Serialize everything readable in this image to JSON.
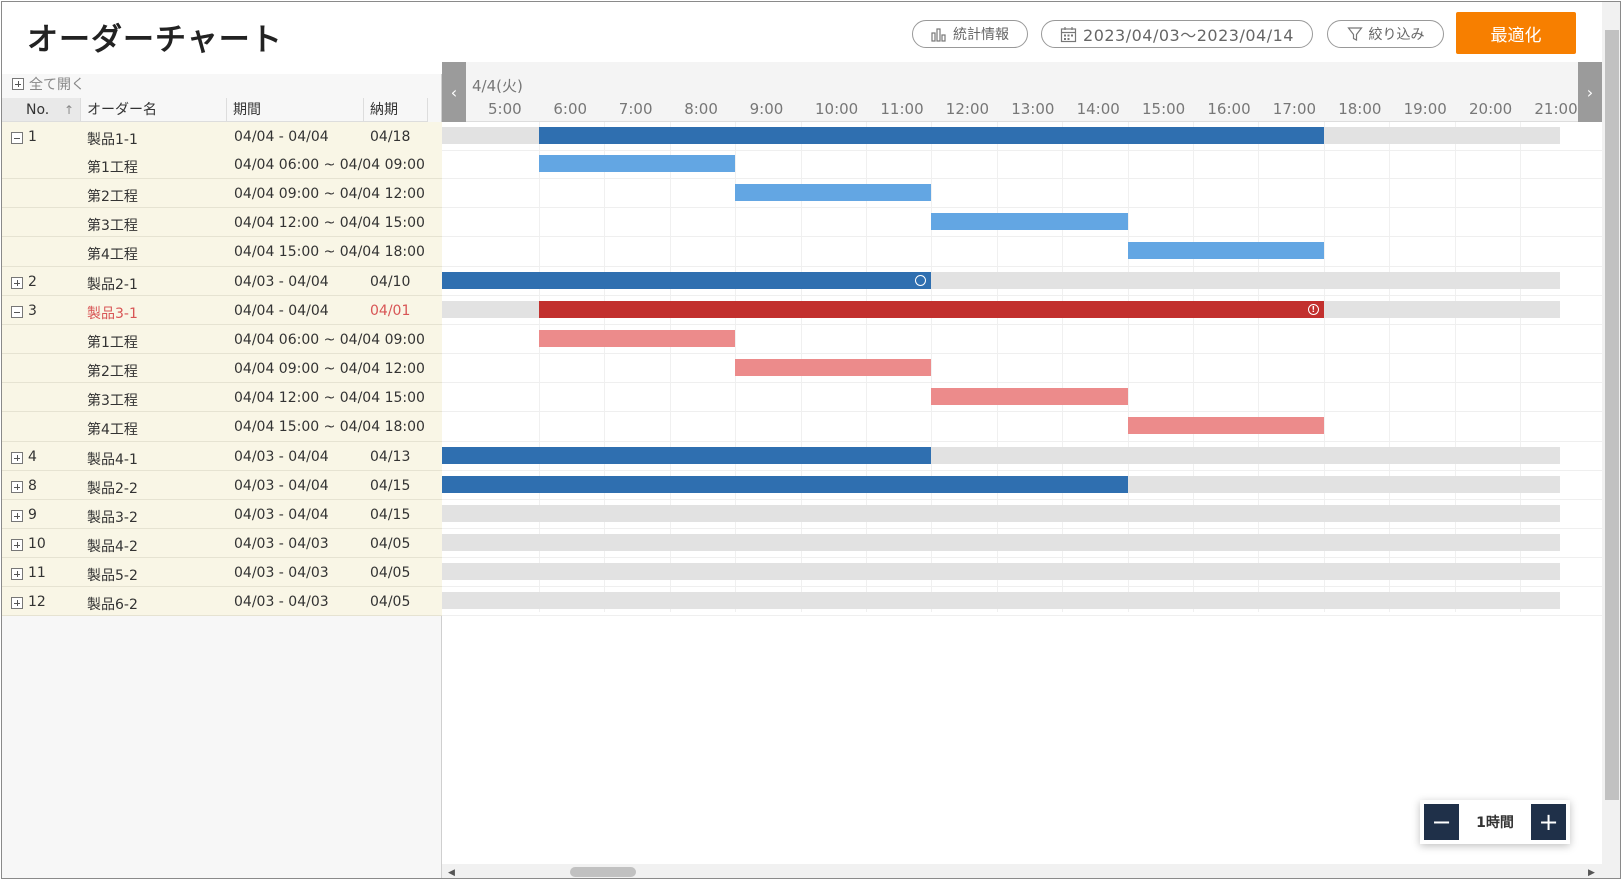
{
  "header": {
    "title": "オーダーチャート",
    "stats_label": "統計情報",
    "date_range": "2023/04/03〜2023/04/14",
    "filter_label": "絞り込み",
    "optimize_label": "最適化",
    "accent_color": "#f77f00"
  },
  "left": {
    "expand_all": "全て開く",
    "columns": {
      "no": "No.",
      "sort_icon": "↑",
      "name": "オーダー名",
      "period": "期間",
      "due": "納期"
    },
    "rows": [
      {
        "toggle": "minus",
        "no": "1",
        "name": "製品1-1",
        "period": "04/04 - 04/04",
        "due": "04/18",
        "kind": "order"
      },
      {
        "toggle": "",
        "no": "",
        "name": "第1工程",
        "period": "04/04 06:00 ~ 04/04 09:00",
        "due": "",
        "kind": "step"
      },
      {
        "toggle": "",
        "no": "",
        "name": "第2工程",
        "period": "04/04 09:00 ~ 04/04 12:00",
        "due": "",
        "kind": "step"
      },
      {
        "toggle": "",
        "no": "",
        "name": "第3工程",
        "period": "04/04 12:00 ~ 04/04 15:00",
        "due": "",
        "kind": "step"
      },
      {
        "toggle": "",
        "no": "",
        "name": "第4工程",
        "period": "04/04 15:00 ~ 04/04 18:00",
        "due": "",
        "kind": "step"
      },
      {
        "toggle": "plus",
        "no": "2",
        "name": "製品2-1",
        "period": "04/03 - 04/04",
        "due": "04/10",
        "kind": "order"
      },
      {
        "toggle": "minus",
        "no": "3",
        "name": "製品3-1",
        "period": "04/04 - 04/04",
        "due": "04/01",
        "kind": "order",
        "late": true
      },
      {
        "toggle": "",
        "no": "",
        "name": "第1工程",
        "period": "04/04 06:00 ~ 04/04 09:00",
        "due": "",
        "kind": "step"
      },
      {
        "toggle": "",
        "no": "",
        "name": "第2工程",
        "period": "04/04 09:00 ~ 04/04 12:00",
        "due": "",
        "kind": "step"
      },
      {
        "toggle": "",
        "no": "",
        "name": "第3工程",
        "period": "04/04 12:00 ~ 04/04 15:00",
        "due": "",
        "kind": "step"
      },
      {
        "toggle": "",
        "no": "",
        "name": "第4工程",
        "period": "04/04 15:00 ~ 04/04 18:00",
        "due": "",
        "kind": "step"
      },
      {
        "toggle": "plus",
        "no": "4",
        "name": "製品4-1",
        "period": "04/03 - 04/04",
        "due": "04/13",
        "kind": "order"
      },
      {
        "toggle": "plus",
        "no": "8",
        "name": "製品2-2",
        "period": "04/03 - 04/04",
        "due": "04/15",
        "kind": "order"
      },
      {
        "toggle": "plus",
        "no": "9",
        "name": "製品3-2",
        "period": "04/03 - 04/04",
        "due": "04/15",
        "kind": "order"
      },
      {
        "toggle": "plus",
        "no": "10",
        "name": "製品4-2",
        "period": "04/03 - 04/03",
        "due": "04/05",
        "kind": "order"
      },
      {
        "toggle": "plus",
        "no": "11",
        "name": "製品5-2",
        "period": "04/03 - 04/03",
        "due": "04/05",
        "kind": "order"
      },
      {
        "toggle": "plus",
        "no": "12",
        "name": "製品6-2",
        "period": "04/03 - 04/03",
        "due": "04/05",
        "kind": "order"
      }
    ]
  },
  "timeline": {
    "date_label": "4/4(火)",
    "hours": [
      "5:00",
      "6:00",
      "7:00",
      "8:00",
      "9:00",
      "10:00",
      "11:00",
      "12:00",
      "13:00",
      "14:00",
      "15:00",
      "16:00",
      "17:00",
      "18:00",
      "19:00",
      "20:00",
      "21:00"
    ],
    "bars": [
      {
        "row": 0,
        "bg": true,
        "start": 6,
        "end": 18,
        "style": "dark"
      },
      {
        "row": 1,
        "start": 6,
        "end": 9,
        "style": "light"
      },
      {
        "row": 2,
        "start": 9,
        "end": 12,
        "style": "light"
      },
      {
        "row": 3,
        "start": 12,
        "end": 15,
        "style": "light"
      },
      {
        "row": 4,
        "start": 15,
        "end": 18,
        "style": "light"
      },
      {
        "row": 5,
        "bg": true,
        "start": 3.3,
        "end": 12,
        "style": "dark",
        "marker": "lock"
      },
      {
        "row": 6,
        "bg": true,
        "start": 6,
        "end": 18,
        "style": "red",
        "marker": "alert"
      },
      {
        "row": 7,
        "start": 6,
        "end": 9,
        "style": "pink"
      },
      {
        "row": 8,
        "start": 9,
        "end": 12,
        "style": "pink"
      },
      {
        "row": 9,
        "start": 12,
        "end": 15,
        "style": "pink"
      },
      {
        "row": 10,
        "start": 15,
        "end": 18,
        "style": "pink"
      },
      {
        "row": 11,
        "bg": true,
        "start": 3.3,
        "end": 12,
        "style": "dark"
      },
      {
        "row": 12,
        "bg": true,
        "start": 3.3,
        "end": 15,
        "style": "dark"
      },
      {
        "row": 13,
        "bg": true
      },
      {
        "row": 14,
        "bg": true
      },
      {
        "row": 15,
        "bg": true
      },
      {
        "row": 16,
        "bg": true
      }
    ]
  },
  "zoom": {
    "minus": "−",
    "label": "1時間",
    "plus": "+"
  }
}
